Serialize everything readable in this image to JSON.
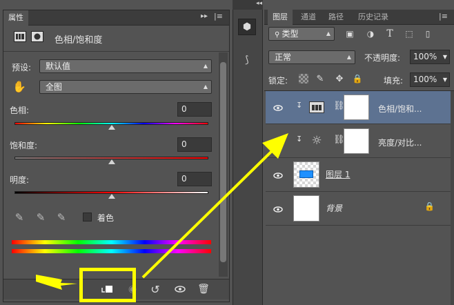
{
  "properties": {
    "tab_label": "属性",
    "header_title": "色相/饱和度",
    "preset_label": "预设:",
    "preset_value": "默认值",
    "channel_value": "全图",
    "hue_label": "色相:",
    "hue_value": "0",
    "saturation_label": "饱和度:",
    "saturation_value": "0",
    "lightness_label": "明度:",
    "lightness_value": "0",
    "colorize_label": "着色",
    "hue_pct": 0.5,
    "saturation_pct": 0.5,
    "lightness_pct": 0.5
  },
  "layers": {
    "tabs": [
      "图层",
      "通道",
      "路径",
      "历史记录"
    ],
    "filter_value": "类型",
    "blend_mode": "正常",
    "opacity_label": "不透明度:",
    "opacity_value": "100%",
    "lock_label": "锁定:",
    "fill_label": "填充:",
    "fill_value": "100%",
    "rows": [
      {
        "name": "色相/饱和..."
      },
      {
        "name": "亮度/对比..."
      },
      {
        "name": "图层 1"
      },
      {
        "name": "背景"
      }
    ]
  },
  "colors": {
    "panel_bg": "#535353",
    "selected_row": "#5d7291",
    "annotation": "#ffff00"
  }
}
